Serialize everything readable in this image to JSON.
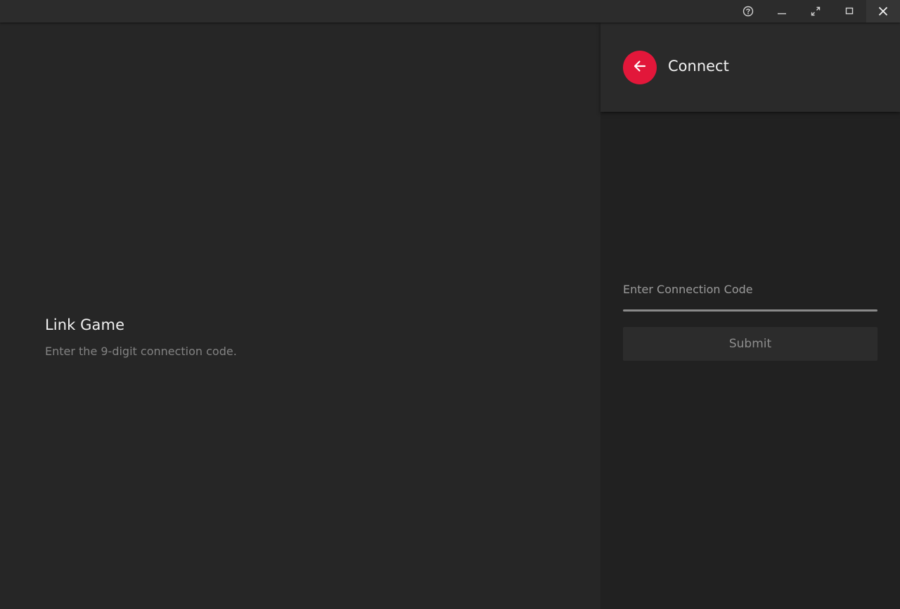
{
  "titlebar": {
    "buttons": [
      {
        "icon": "help-icon"
      },
      {
        "icon": "minimize-icon"
      },
      {
        "icon": "fullscreen-icon"
      },
      {
        "icon": "maximize-icon"
      },
      {
        "icon": "close-icon"
      }
    ]
  },
  "main": {
    "title": "Link Game",
    "subtitle": "Enter the 9-digit connection code."
  },
  "side": {
    "back_icon": "back-arrow-icon",
    "title": "Connect",
    "input_label": "Enter Connection Code",
    "input_value": "",
    "submit_label": "Submit"
  },
  "colors": {
    "accent": "#e2173a",
    "background": "#262626",
    "panel": "#212121",
    "header": "#2a2a2a"
  }
}
